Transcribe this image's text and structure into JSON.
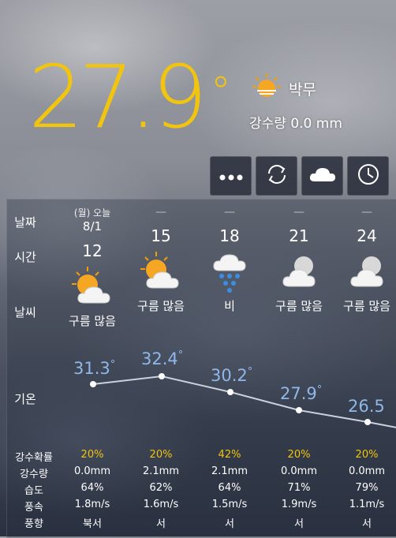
{
  "current": {
    "temp": "27.9",
    "degree_symbol": "°",
    "condition": "박무",
    "condition_icon": "sun-haze-icon",
    "rain": "강수량 0.0 mm"
  },
  "toolbar": {
    "more_icon": "more-icon",
    "refresh_icon": "refresh-icon",
    "cloud_icon": "cloud-icon",
    "clock_icon": "clock-icon"
  },
  "labels": {
    "date": "날짜",
    "time": "시간",
    "weather": "날씨",
    "temperature": "기온",
    "precip_prob": "강수확률",
    "precip": "강수량",
    "humidity": "습도",
    "wind_speed": "풍속",
    "wind_dir": "풍향"
  },
  "forecast": [
    {
      "date_top": "(월) 오늘",
      "date": "8/1",
      "time": "12",
      "icon": "sun-cloud-icon",
      "desc": "구름 많음",
      "temp": "31.3",
      "prob": "20%",
      "precip": "0.0mm",
      "humidity": "64%",
      "wind_speed": "1.8m/s",
      "wind_dir": "북서"
    },
    {
      "date_top": "",
      "date": "—",
      "time": "15",
      "icon": "sun-cloud-icon",
      "desc": "구름 많음",
      "temp": "32.4",
      "prob": "20%",
      "precip": "2.1mm",
      "humidity": "62%",
      "wind_speed": "1.6m/s",
      "wind_dir": "서"
    },
    {
      "date_top": "",
      "date": "—",
      "time": "18",
      "icon": "rain-cloud-icon",
      "desc": "비",
      "temp": "30.2",
      "prob": "42%",
      "precip": "2.1mm",
      "humidity": "64%",
      "wind_speed": "1.5m/s",
      "wind_dir": "서"
    },
    {
      "date_top": "",
      "date": "—",
      "time": "21",
      "icon": "moon-cloud-icon",
      "desc": "구름 많음",
      "temp": "27.9",
      "prob": "20%",
      "precip": "0.0mm",
      "humidity": "71%",
      "wind_speed": "1.9m/s",
      "wind_dir": "서"
    },
    {
      "date_top": "",
      "date": "—",
      "time": "24",
      "icon": "moon-cloud-icon",
      "desc": "구름 많음",
      "temp": "26.5",
      "prob": "20%",
      "precip": "0.0mm",
      "humidity": "79%",
      "wind_speed": "1.1m/s",
      "wind_dir": "서"
    }
  ],
  "colors": {
    "accent_yellow": "#f1c40f",
    "temp_blue": "#8fb8e8"
  }
}
